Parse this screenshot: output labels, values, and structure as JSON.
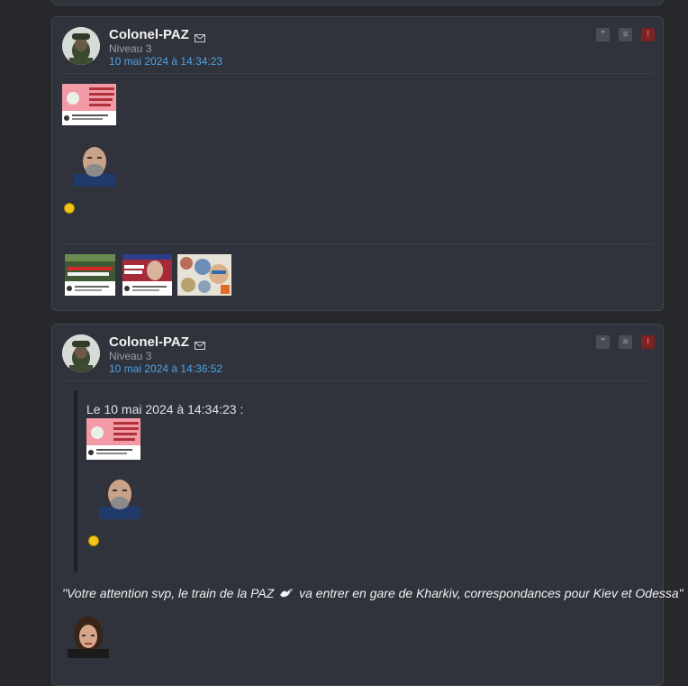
{
  "posts": [
    {
      "username": "Colonel-PAZ",
      "level": "Niveau 3",
      "date": "10 mai 2024 à 14:34:23",
      "actions": [
        {
          "icon": "quote-icon",
          "glyph": "”"
        },
        {
          "icon": "reply-icon",
          "glyph": "≡"
        },
        {
          "icon": "report-icon",
          "glyph": "!"
        }
      ],
      "attachments": [
        {
          "icon": "video-thumbnail-counteroffensive",
          "caption": "Comprendre l'échec de la contre-offensive"
        },
        {
          "icon": "video-thumbnail-putin",
          "caption": "Les chiffres choc du ..."
        },
        {
          "icon": "collage-thumbnail"
        }
      ]
    },
    {
      "username": "Colonel-PAZ",
      "level": "Niveau 3",
      "date": "10 mai 2024 à 14:36:52",
      "actions": [
        {
          "icon": "quote-icon",
          "glyph": "”"
        },
        {
          "icon": "reply-icon",
          "glyph": "≡"
        },
        {
          "icon": "report-icon",
          "glyph": "!"
        }
      ],
      "quote_header": "Le 10 mai 2024 à 14:34:23 :",
      "message_before": "\"Votre attention svp, le train de la PAZ",
      "message_after": "va entrer en gare de Kharkiv, correspondances pour Kiev et Odessa\""
    }
  ],
  "colors": {
    "background": "#26282c",
    "post_background": "#30333b",
    "accent_date": "#4ba3e8",
    "alert": "#7a2424"
  }
}
